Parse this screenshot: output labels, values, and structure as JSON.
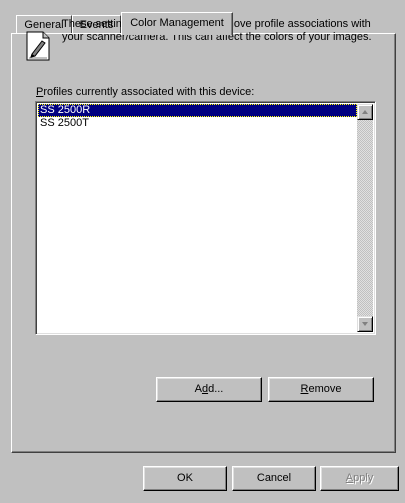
{
  "tabs": [
    {
      "label": "General",
      "active": false
    },
    {
      "label": "Events",
      "active": false
    },
    {
      "label": "Color Management",
      "active": true
    }
  ],
  "info": {
    "icon": "document-pen-icon",
    "text": "These settings let you add and remove profile associations with your scanner/camera. This can affect the colors of your images."
  },
  "profiles": {
    "label_mnemonic": "P",
    "label_rest": "rofiles currently associated with this device:",
    "items": [
      {
        "name": "SS 2500R",
        "selected": true
      },
      {
        "name": "SS 2500T",
        "selected": false
      }
    ]
  },
  "buttons": {
    "add_pre": "A",
    "add_mnemonic": "d",
    "add_post": "d...",
    "remove_mnemonic": "R",
    "remove_rest": "emove",
    "ok": "OK",
    "cancel": "Cancel",
    "apply_mnemonic": "A",
    "apply_rest": "pply"
  },
  "colors": {
    "face": "#c0c0c0",
    "selection": "#000080",
    "disabled_text": "#808080"
  }
}
